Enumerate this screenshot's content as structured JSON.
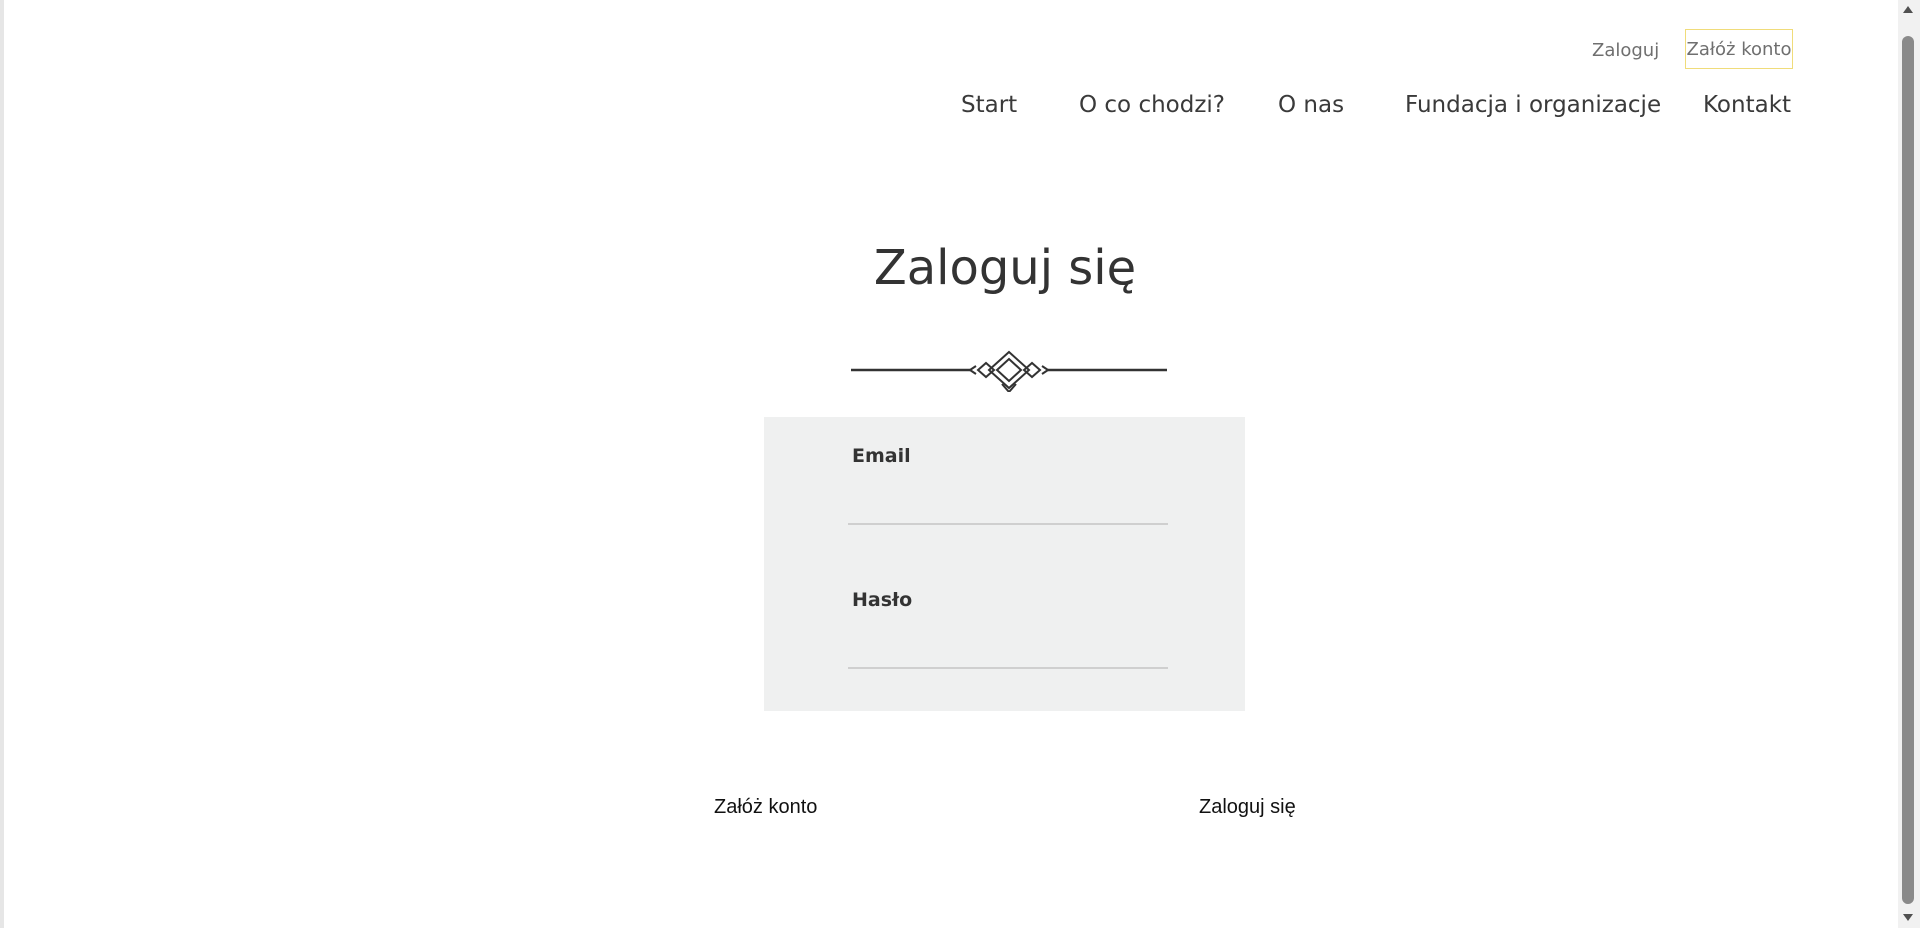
{
  "header": {
    "login_link": "Zaloguj",
    "register_link": "Załóż konto"
  },
  "nav": {
    "items": [
      {
        "label": "Start"
      },
      {
        "label": "O co chodzi?"
      },
      {
        "label": "O nas"
      },
      {
        "label": "Fundacja i organizacje"
      },
      {
        "label": "Kontakt"
      }
    ]
  },
  "main": {
    "title": "Zaloguj się",
    "form": {
      "email_label": "Email",
      "email_value": "",
      "password_label": "Hasło",
      "password_value": ""
    },
    "actions": {
      "register": "Załóż konto",
      "login": "Zaloguj się"
    }
  },
  "colors": {
    "panel_background": "#eff0f0",
    "register_border": "#f0dc7a",
    "text": "#333333"
  },
  "icons": {
    "ornament": "divider-ornament-icon"
  }
}
